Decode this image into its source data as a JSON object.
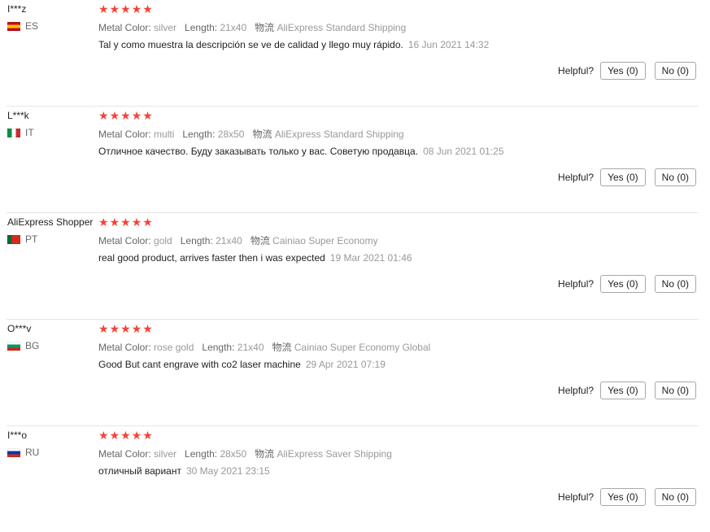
{
  "helpful_label": "Helpful?",
  "star_color": "#f44336",
  "reviews": [
    {
      "user": "I***z",
      "country": "ES",
      "flag_colors": [
        "#c60b1e",
        "#ffc400",
        "#c60b1e"
      ],
      "flag_direction": "horizontal",
      "stars": 5,
      "attrs": [
        {
          "k": "Metal Color:",
          "v": "silver"
        },
        {
          "k": "Length:",
          "v": "21x40"
        },
        {
          "k": "物流",
          "v": "AliExpress Standard Shipping"
        }
      ],
      "text": "Tal y como muestra la descripción se ve de calidad y llego muy rápido.",
      "date": "16 Jun 2021 14:32",
      "yes": "Yes (0)",
      "no": "No (0)"
    },
    {
      "user": "L***k",
      "country": "IT",
      "flag_colors": [
        "#009246",
        "#ffffff",
        "#ce2b37"
      ],
      "flag_direction": "vertical",
      "stars": 5,
      "attrs": [
        {
          "k": "Metal Color:",
          "v": "multi"
        },
        {
          "k": "Length:",
          "v": "28x50"
        },
        {
          "k": "物流",
          "v": "AliExpress Standard Shipping"
        }
      ],
      "text": "Отличное качество. Буду заказывать только у вас. Советую продавца.",
      "date": "08 Jun 2021 01:25",
      "yes": "Yes (0)",
      "no": "No (0)"
    },
    {
      "user": "AliExpress Shopper",
      "country": "PT",
      "flag_colors": [
        "#046a38",
        "#da291c",
        "#da291c"
      ],
      "flag_direction": "vertical",
      "stars": 5,
      "attrs": [
        {
          "k": "Metal Color:",
          "v": "gold"
        },
        {
          "k": "Length:",
          "v": "21x40"
        },
        {
          "k": "物流",
          "v": "Cainiao Super Economy"
        }
      ],
      "text": "real good product, arrives faster then i was expected",
      "date": "19 Mar 2021 01:46",
      "yes": "Yes (0)",
      "no": "No (0)"
    },
    {
      "user": "O***v",
      "country": "BG",
      "flag_colors": [
        "#ffffff",
        "#00966e",
        "#d62612"
      ],
      "flag_direction": "horizontal",
      "stars": 5,
      "attrs": [
        {
          "k": "Metal Color:",
          "v": "rose gold"
        },
        {
          "k": "Length:",
          "v": "21x40"
        },
        {
          "k": "物流",
          "v": "Cainiao Super Economy Global"
        }
      ],
      "text": "Good But cant engrave with co2 laser machine",
      "date": "29 Apr 2021 07:19",
      "yes": "Yes (0)",
      "no": "No (0)"
    },
    {
      "user": "I***o",
      "country": "RU",
      "flag_colors": [
        "#ffffff",
        "#0039a6",
        "#d52b1e"
      ],
      "flag_direction": "horizontal",
      "stars": 5,
      "attrs": [
        {
          "k": "Metal Color:",
          "v": "silver"
        },
        {
          "k": "Length:",
          "v": "28x50"
        },
        {
          "k": "物流",
          "v": "AliExpress Saver Shipping"
        }
      ],
      "text": "отличный вариант",
      "date": "30 May 2021 23:15",
      "yes": "Yes (0)",
      "no": "No (0)"
    }
  ]
}
